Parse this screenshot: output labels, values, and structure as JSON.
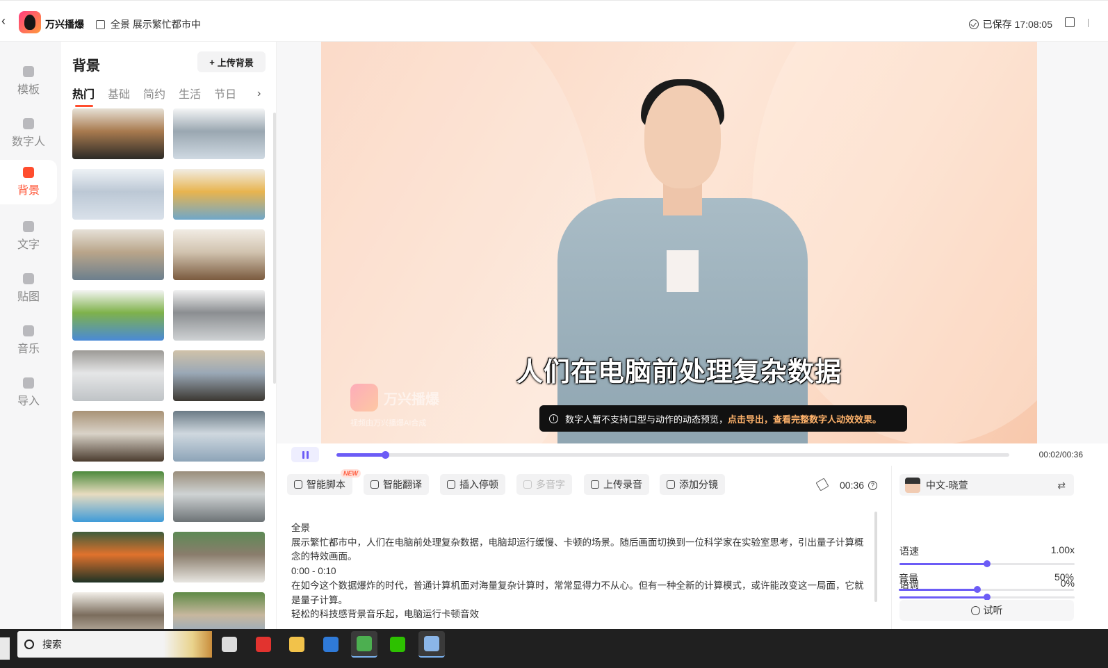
{
  "header": {
    "brand": "万兴播爆",
    "project_title": "全景 展示繁忙都市中",
    "saved_status": "已保存 17:08:05"
  },
  "leftnav": {
    "items": [
      {
        "label": "模板",
        "icon": "template-icon",
        "active": false
      },
      {
        "label": "数字人",
        "icon": "avatar-icon",
        "active": false
      },
      {
        "label": "背景",
        "icon": "background-icon",
        "active": true
      },
      {
        "label": "文字",
        "icon": "text-icon",
        "active": false
      },
      {
        "label": "贴图",
        "icon": "sticker-icon",
        "active": false
      },
      {
        "label": "音乐",
        "icon": "music-icon",
        "active": false
      },
      {
        "label": "导入",
        "icon": "import-icon",
        "active": false
      }
    ]
  },
  "panel": {
    "title": "背景",
    "upload_label": "上传背景",
    "tabs": [
      "热门",
      "基础",
      "简约",
      "生活",
      "节日"
    ],
    "active_tab": "热门",
    "thumbnails": [
      {
        "name": "gym-hall",
        "colors": [
          "#2c2a27",
          "#a87a4f",
          "#e7e1d6"
        ]
      },
      {
        "name": "classroom",
        "colors": [
          "#cfd9e2",
          "#9aa7b1",
          "#f4f5f6"
        ]
      },
      {
        "name": "computer-lab",
        "colors": [
          "#d9e1ea",
          "#bcc8d5",
          "#eef2f6"
        ]
      },
      {
        "name": "kids-classroom",
        "colors": [
          "#6fa7c9",
          "#e8b44f",
          "#f1ede4"
        ]
      },
      {
        "name": "lake-living-room",
        "colors": [
          "#6c7f8d",
          "#b9a58a",
          "#e6e1d8"
        ]
      },
      {
        "name": "warm-living-room",
        "colors": [
          "#7a5a3e",
          "#d1c3af",
          "#f1ece4"
        ]
      },
      {
        "name": "white-house",
        "colors": [
          "#4a8ad7",
          "#7fb24b",
          "#f5f5f5"
        ]
      },
      {
        "name": "modern-kitchen",
        "colors": [
          "#cfd2d4",
          "#8b8e91",
          "#f2f2f2"
        ]
      },
      {
        "name": "white-kitchen",
        "colors": [
          "#bfc3c6",
          "#e5e6e7",
          "#9c9a96"
        ]
      },
      {
        "name": "city-study",
        "colors": [
          "#3b3731",
          "#9aa8b6",
          "#d0c2a9"
        ]
      },
      {
        "name": "library-office",
        "colors": [
          "#4b3c2f",
          "#d9d3c8",
          "#a89276"
        ]
      },
      {
        "name": "glass-office",
        "colors": [
          "#8da4b8",
          "#cfd8df",
          "#6b7b86"
        ]
      },
      {
        "name": "tropical-beach",
        "colors": [
          "#3f9bd8",
          "#e8dcc0",
          "#4c8a3c"
        ]
      },
      {
        "name": "meeting-room",
        "colors": [
          "#6d7376",
          "#cfd3d4",
          "#9a8e7b"
        ]
      },
      {
        "name": "forest-camp",
        "colors": [
          "#1f3325",
          "#e0722d",
          "#3e5c3b"
        ]
      },
      {
        "name": "bright-office",
        "colors": [
          "#e8e6e1",
          "#8a7d6c",
          "#5d8a55"
        ]
      },
      {
        "name": "cozy-lounge",
        "colors": [
          "#d9d0c2",
          "#7b6d5d",
          "#f2efe9"
        ]
      },
      {
        "name": "suburban-home",
        "colors": [
          "#7fa6cf",
          "#c7b79e",
          "#5f8a46"
        ]
      }
    ]
  },
  "preview": {
    "subtitle": "人们在电脑前处理复杂数据",
    "watermark_brand": "万兴播爆",
    "watermark_sub": "视频由万兴播爆AI合成",
    "toast_text": "数字人暂不支持口型与动作的动态预览，",
    "toast_highlight": "点击导出，查看完整数字人动效效果。",
    "time": "00:02/00:36",
    "progress": 0.072,
    "colors": {
      "accent": "#6c5cf6"
    }
  },
  "toolbar": {
    "buttons": [
      {
        "label": "智能脚本",
        "icon": "script-icon",
        "disabled": false,
        "badge": "NEW"
      },
      {
        "label": "智能翻译",
        "icon": "translate-icon",
        "disabled": false,
        "badge": ""
      },
      {
        "label": "插入停顿",
        "icon": "pause-clock-icon",
        "disabled": false,
        "badge": ""
      },
      {
        "label": "多音字",
        "icon": "polyphone-icon",
        "disabled": true,
        "badge": ""
      },
      {
        "label": "上传录音",
        "icon": "microphone-icon",
        "disabled": false,
        "badge": ""
      },
      {
        "label": "添加分镜",
        "icon": "scene-split-icon",
        "disabled": false,
        "badge": ""
      }
    ],
    "duration": "00:36"
  },
  "script": {
    "lines": [
      "全景",
      "展示繁忙都市中，人们在电脑前处理复杂数据，电脑却运行缓慢、卡顿的场景。随后画面切换到一位科学家在实验室思考，引出量子计算概念的特效画面。",
      "0:00 - 0:10",
      "在如今这个数据爆炸的时代，普通计算机面对海量复杂计算时，常常显得力不从心。但有一种全新的计算模式，或许能改变这一局面，它就是量子计算。",
      "轻松的科技感背景音乐起，电脑运行卡顿音效"
    ]
  },
  "voice": {
    "name": "中文-晓萱",
    "speed_label": "语速",
    "speed_value": "1.00x",
    "speed_level": 0.5,
    "pitch_label": "语调",
    "pitch_value": "0%",
    "pitch_level": 0.5,
    "volume_label": "音量",
    "volume_value": "50%",
    "volume_level": 0.45,
    "try_label": "试听"
  },
  "taskbar": {
    "search_placeholder": "搜索",
    "apps": [
      {
        "name": "task-view-icon",
        "color": "#dcdcdc"
      },
      {
        "name": "wps-icon",
        "color": "#e2332f"
      },
      {
        "name": "file-explorer-icon",
        "color": "#f2c24a"
      },
      {
        "name": "store-icon",
        "color": "#2f7ad8"
      },
      {
        "name": "chrome-icon",
        "color": "#4caf50"
      },
      {
        "name": "wechat-icon",
        "color": "#2dc100"
      },
      {
        "name": "avatar-app-icon",
        "color": "#8bb6e8"
      }
    ]
  }
}
